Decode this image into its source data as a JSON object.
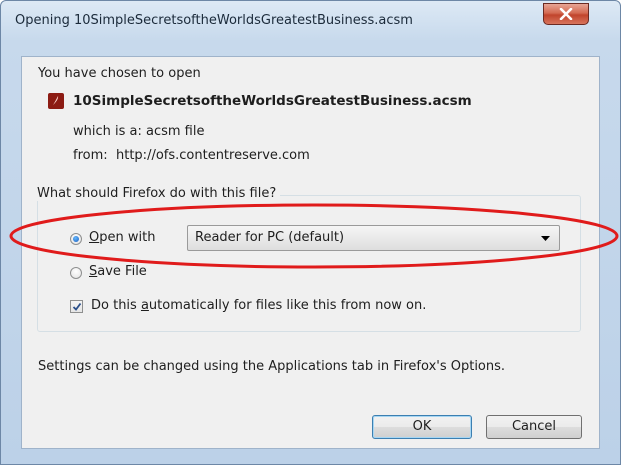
{
  "window": {
    "title": "Opening 10SimpleSecretsoftheWorldsGreatestBusiness.acsm"
  },
  "dialog": {
    "intro": "You have chosen to open",
    "file_icon": "adobe-reader-icon",
    "file_name": "10SimpleSecretsoftheWorldsGreatestBusiness.acsm",
    "which_label": "which is a:",
    "which_value": "acsm file",
    "from_label": "from:",
    "from_value": "http://ofs.contentreserve.com",
    "question": "What should Firefox do with this file?",
    "open_with": {
      "mnemonic": "O",
      "rest": "pen with",
      "selected": true,
      "app": "Reader for PC (default)"
    },
    "save_file": {
      "mnemonic": "S",
      "rest": "ave File",
      "selected": false
    },
    "auto": {
      "prefix": "Do this ",
      "mnemonic": "a",
      "rest": "utomatically for files like this from now on.",
      "checked": true
    },
    "settings_note": "Settings can be changed using the Applications tab in Firefox's Options.",
    "ok_label": "OK",
    "cancel_label": "Cancel"
  },
  "annotation": {
    "color": "#e01b1b",
    "shape": "ellipse-around-open-with-row"
  }
}
